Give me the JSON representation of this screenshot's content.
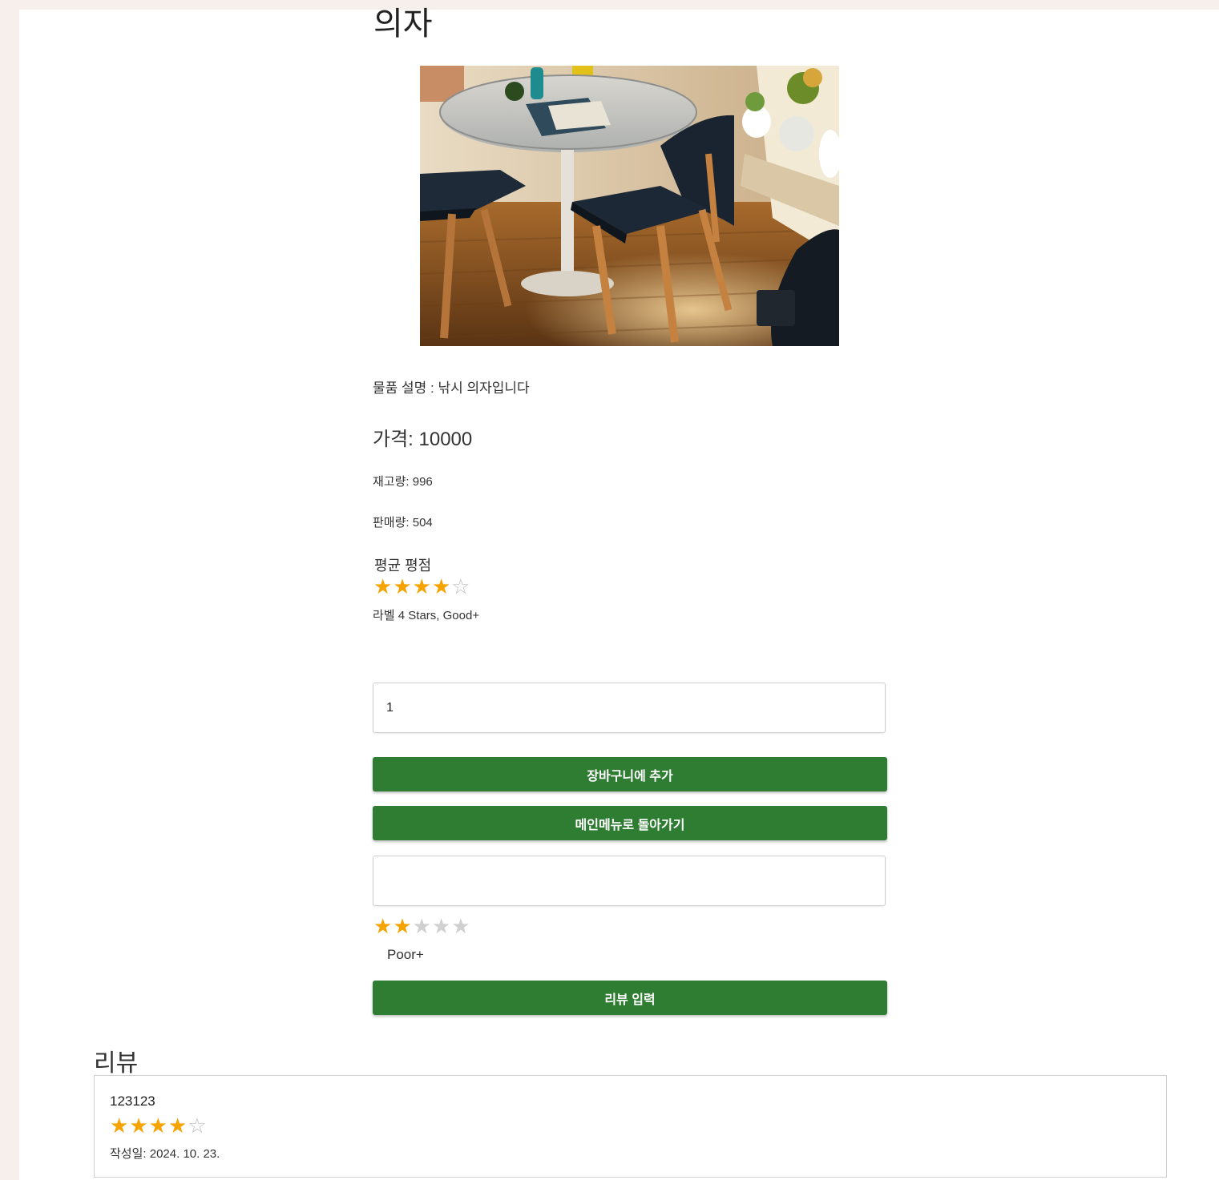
{
  "product": {
    "name": "의자",
    "image_alt": "의자 사진",
    "description": "물품 설명 : 낚시 의자입니다",
    "price_text": "가격: 10000",
    "stock_text": "재고량: 996",
    "sales_text": "판매량: 504"
  },
  "rating": {
    "heading": "평균 평점",
    "value": 4,
    "max": 5,
    "label": "라벨 4 Stars, Good+"
  },
  "order": {
    "quantity_value": "1",
    "add_to_cart_label": "장바구니에 추가",
    "back_to_main_label": "메인메뉴로 돌아가기"
  },
  "review_form": {
    "text_value": "",
    "rating_value": 2,
    "rating_max": 5,
    "rating_label": "Poor+",
    "submit_label": "리뷰 입력"
  },
  "reviews": {
    "heading": "리뷰",
    "items": [
      {
        "content": "123123",
        "rating": 4,
        "max": 5,
        "date_text": "작성일: 2024. 10. 23."
      }
    ]
  },
  "colors": {
    "star_filled": "#f6a300",
    "button_green": "#2e7d32",
    "background": "#f7efec"
  },
  "icons": {
    "star_filled": "star-icon",
    "star_outline": "star-outline-icon",
    "star_empty": "star-empty-icon"
  }
}
